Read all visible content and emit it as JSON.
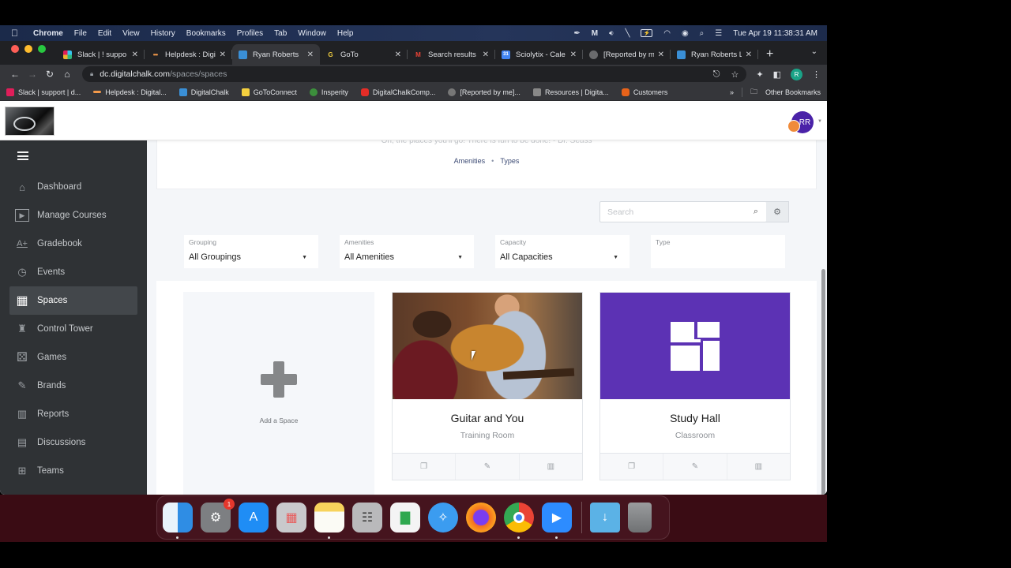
{
  "menubar": {
    "apple_icon": "apple-icon",
    "items": [
      "Chrome",
      "File",
      "Edit",
      "View",
      "History",
      "Bookmarks",
      "Profiles",
      "Tab",
      "Window",
      "Help"
    ],
    "status_icons": [
      "feather-icon",
      "malwarebytes-icon",
      "volume-icon",
      "bluetooth-off-icon",
      "battery-icon",
      "wifi-icon",
      "user-switch-icon",
      "spotlight-search-icon",
      "control-center-icon"
    ],
    "clock": "Tue Apr 19  11:38:31 AM"
  },
  "browser": {
    "tabs": [
      {
        "title": "Slack | ! suppo",
        "icon": "slack-icon",
        "active": false
      },
      {
        "title": "Helpdesk : Digi",
        "icon": "helpdesk-icon",
        "active": false
      },
      {
        "title": "Ryan Roberts",
        "icon": "digitalchalk-icon",
        "active": true
      },
      {
        "title": "GoTo",
        "icon": "goto-icon",
        "active": false
      },
      {
        "title": "Search results",
        "icon": "gmail-icon",
        "active": false
      },
      {
        "title": "Sciolytix - Cale",
        "icon": "calendar-icon",
        "active": false
      },
      {
        "title": "[Reported by m",
        "icon": "globe-icon",
        "active": false
      },
      {
        "title": "Ryan Roberts L",
        "icon": "digitalchalk-icon",
        "active": false
      }
    ],
    "url_host": "dc.digitalchalk.com",
    "url_path": "/spaces/spaces",
    "profile_initial": "R",
    "bookmarks": [
      {
        "label": "Slack | support | d...",
        "color": "#e01e5a"
      },
      {
        "label": "Helpdesk : Digital...",
        "color": "#f2994a"
      },
      {
        "label": "DigitalChalk",
        "color": "#3a8fd6"
      },
      {
        "label": "GoToConnect",
        "color": "#f4d03f"
      },
      {
        "label": "Insperity",
        "color": "#3c8f3c"
      },
      {
        "label": "DigitalChalkComp...",
        "color": "#e52d27"
      },
      {
        "label": "[Reported by me]...",
        "color": "#777"
      },
      {
        "label": "Resources | Digita...",
        "color": "#888"
      },
      {
        "label": "Customers",
        "color": "#e8631a"
      }
    ],
    "overflow": "»",
    "other_bookmarks": "Other Bookmarks"
  },
  "app": {
    "avatar_initials": "RR",
    "sidebar": [
      {
        "label": "Dashboard",
        "icon": "home-icon",
        "glyph": "⌂",
        "active": false
      },
      {
        "label": "Manage Courses",
        "icon": "course-play-icon",
        "glyph": "▶",
        "active": false
      },
      {
        "label": "Gradebook",
        "icon": "grade-a-plus-icon",
        "glyph": "A+",
        "active": false
      },
      {
        "label": "Events",
        "icon": "calendar-clock-icon",
        "glyph": "◷",
        "active": false
      },
      {
        "label": "Spaces",
        "icon": "floorplan-icon",
        "glyph": "▦",
        "active": true
      },
      {
        "label": "Control Tower",
        "icon": "control-tower-icon",
        "glyph": "♜",
        "active": false
      },
      {
        "label": "Games",
        "icon": "games-icon",
        "glyph": "⚄",
        "active": false
      },
      {
        "label": "Brands",
        "icon": "brand-edit-icon",
        "glyph": "✎",
        "active": false
      },
      {
        "label": "Reports",
        "icon": "bar-chart-icon",
        "glyph": "▥",
        "active": false
      },
      {
        "label": "Discussions",
        "icon": "chat-icon",
        "glyph": "▤",
        "active": false
      },
      {
        "label": "Teams",
        "icon": "org-chart-icon",
        "glyph": "⊞",
        "active": false
      }
    ],
    "quote": "Oh, the places you'll go! There is fun to be done! - Dr. Seuss",
    "sublinks": [
      "Amenities",
      "Types"
    ],
    "search_placeholder": "Search",
    "filters": [
      {
        "label": "Grouping",
        "value": "All Groupings"
      },
      {
        "label": "Amenities",
        "value": "All Amenities"
      },
      {
        "label": "Capacity",
        "value": "All Capacities"
      },
      {
        "label": "Type",
        "value": ""
      }
    ],
    "add_space_label": "Add a Space",
    "spaces": [
      {
        "title": "Guitar and You",
        "type": "Training Room",
        "image": "guitar-lesson-photo"
      },
      {
        "title": "Study Hall",
        "type": "Classroom",
        "image": "floorplan-icon",
        "color": "#5c32b4"
      }
    ]
  },
  "dock": {
    "apps": [
      {
        "name": "Finder",
        "color": "#2f8de4",
        "running": true
      },
      {
        "name": "System Preferences",
        "color": "#7d7f82",
        "running": false,
        "badge": "1"
      },
      {
        "name": "App Store",
        "color": "#1f8df5",
        "running": false
      },
      {
        "name": "Launchpad",
        "color": "#c9c9cc",
        "running": false
      },
      {
        "name": "Notes",
        "color": "#f7d35c",
        "running": true
      },
      {
        "name": "Calculator",
        "color": "#b9b9bb",
        "running": false
      },
      {
        "name": "Numbers",
        "color": "#f4f4f4",
        "running": false
      },
      {
        "name": "Safari",
        "color": "#3b9cf0",
        "running": false
      },
      {
        "name": "Firefox",
        "color": "#f37021",
        "running": false
      },
      {
        "name": "Chrome",
        "color": "#ffffff",
        "running": true
      },
      {
        "name": "Zoom",
        "color": "#2d8cff",
        "running": true
      }
    ],
    "folder": {
      "name": "Downloads",
      "color": "#5bb2e6"
    },
    "trash": {
      "name": "Trash",
      "color": "#8a8c8e"
    }
  }
}
